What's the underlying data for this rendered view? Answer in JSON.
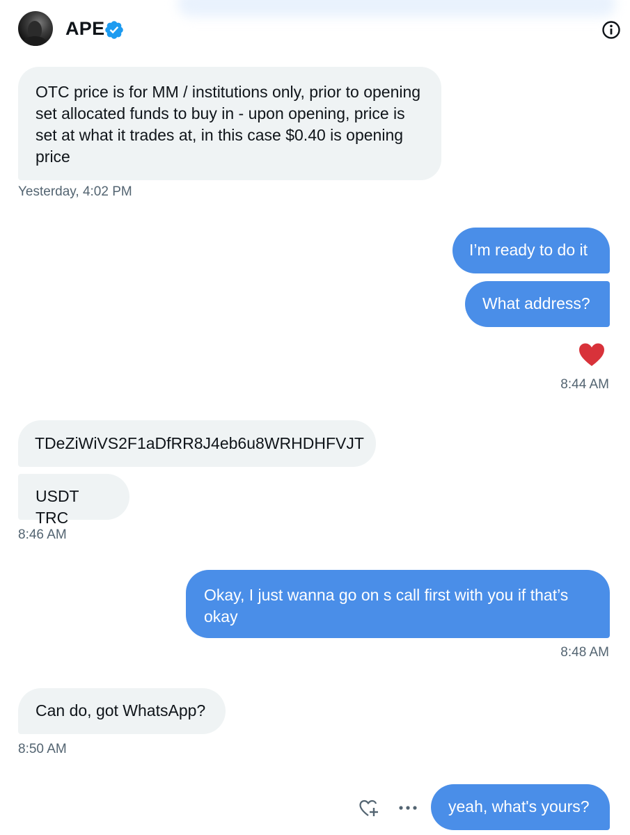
{
  "header": {
    "display_name": "APE",
    "verified_icon": "verified-badge-icon",
    "info_icon": "info-icon"
  },
  "colors": {
    "incoming_bubble": "#eff3f4",
    "outgoing_bubble": "#4a8ee8",
    "timestamp": "#536471",
    "verified": "#1d9bf0",
    "heart": "#e0245e"
  },
  "messages": [
    {
      "direction": "incoming",
      "text": "OTC price is for MM / institutions only, prior to opening set allocated funds to buy in - upon opening, price is set at what it trades at, in this case $0.40 is opening price"
    },
    {
      "direction": "outgoing",
      "text": "I’m ready to do it"
    },
    {
      "direction": "outgoing",
      "text": "What address?"
    },
    {
      "direction": "incoming",
      "text": "TDeZiWiVS2F1aDfRR8J4eb6u8WRHDHFVJT"
    },
    {
      "direction": "incoming",
      "text": "USDT TRC"
    },
    {
      "direction": "outgoing",
      "text": "Okay, I just wanna go on s call first with you if that’s okay"
    },
    {
      "direction": "incoming",
      "text": "Can do, got WhatsApp?"
    },
    {
      "direction": "outgoing",
      "text": "yeah, what's yours?"
    }
  ],
  "timestamps": [
    "Yesterday, 4:02 PM",
    "8:44 AM",
    "8:46 AM",
    "8:48 AM",
    "8:50 AM"
  ],
  "reaction_icon": "heart-icon",
  "message_actions": {
    "react_icon": "add-reaction-icon",
    "more_icon": "more-options-icon"
  }
}
